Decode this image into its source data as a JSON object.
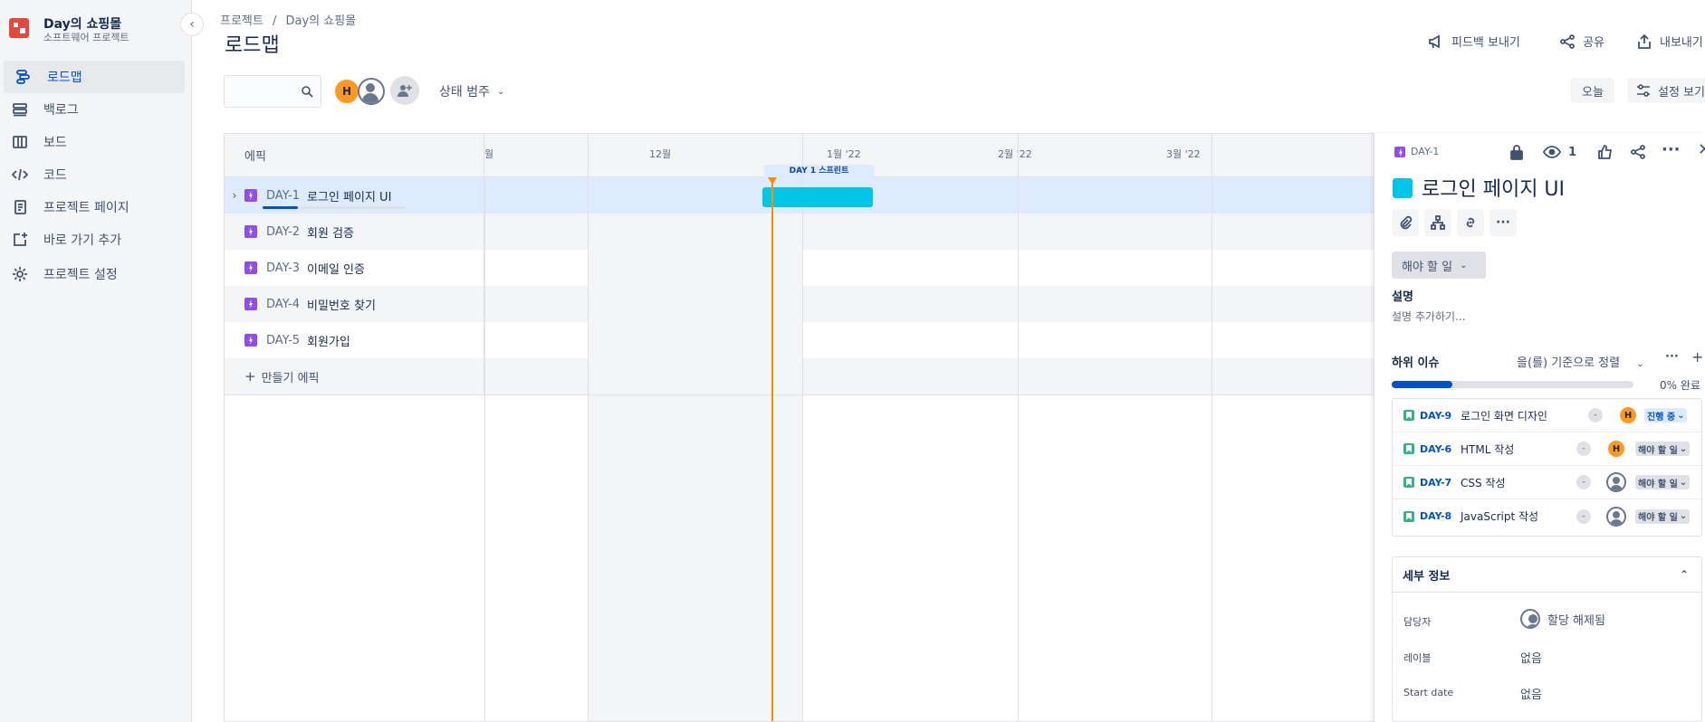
{
  "project": {
    "name": "Day의 쇼핑몰",
    "type": "소프트웨어 프로젝트"
  },
  "sidebar": {
    "items": [
      {
        "label": "로드맵",
        "icon": "roadmap-icon",
        "active": true
      },
      {
        "label": "백로그",
        "icon": "backlog-icon",
        "active": false
      },
      {
        "label": "보드",
        "icon": "board-icon",
        "active": false
      },
      {
        "label": "코드",
        "icon": "code-icon",
        "active": false
      },
      {
        "label": "프로젝트 페이지",
        "icon": "page-icon",
        "active": false
      },
      {
        "label": "바로 가기 추가",
        "icon": "add-shortcut-icon",
        "active": false
      },
      {
        "label": "프로젝트 설정",
        "icon": "gear-icon",
        "active": false
      }
    ]
  },
  "header": {
    "breadcrumb": [
      "프로젝트",
      "/",
      "Day의 쇼핑몰"
    ],
    "title": "로드맵",
    "feedback": "피드백 보내기",
    "share": "공유",
    "export": "내보내기"
  },
  "toolbar": {
    "search_placeholder": "",
    "avatar_initial": "H",
    "status_filter": "상태 범주",
    "today": "오늘",
    "view_settings": "설정 보기"
  },
  "timeline": {
    "epic_header": "에픽",
    "months": [
      "월",
      "12월",
      "1월 '22",
      "2월 '22",
      "3월 '22"
    ],
    "sprint": "DAY 1 스프린트",
    "create": "만들기 에픽",
    "epics": [
      {
        "key": "DAY-1",
        "title": "로그인 페이지 UI",
        "progress": 0.25
      },
      {
        "key": "DAY-2",
        "title": "회원 검증"
      },
      {
        "key": "DAY-3",
        "title": "이메일 인증"
      },
      {
        "key": "DAY-4",
        "title": "비밀번호 찾기"
      },
      {
        "key": "DAY-5",
        "title": "회원가입"
      }
    ]
  },
  "panel": {
    "key": "DAY-1",
    "watchers": "1",
    "title": "로그인 페이지 UI",
    "status": "해야 할 일",
    "description_label": "설명",
    "description_placeholder": "설명 추가하기...",
    "subissues_label": "하위 이슈",
    "sort_label": "을(를) 기준으로 정렬",
    "progress_text": "0% 완료",
    "subissues": [
      {
        "key": "DAY-9",
        "title": "로그인 화면 디자인",
        "priority": "-",
        "assignee": "H",
        "status": "진행 중",
        "status_kind": "prog"
      },
      {
        "key": "DAY-6",
        "title": "HTML 작성",
        "priority": "-",
        "assignee": "H",
        "status": "해야 할 일",
        "status_kind": "todo"
      },
      {
        "key": "DAY-7",
        "title": "CSS 작성",
        "priority": "-",
        "assignee": "",
        "status": "해야 할 일",
        "status_kind": "todo"
      },
      {
        "key": "DAY-8",
        "title": "JavaScript 작성",
        "priority": "-",
        "assignee": "",
        "status": "해야 할 일",
        "status_kind": "todo"
      }
    ],
    "details_label": "세부 정보",
    "details": [
      {
        "label": "담당자",
        "value": "할당 해제됨"
      },
      {
        "label": "레이블",
        "value": "없음"
      },
      {
        "label": "Start date",
        "value": "없음"
      }
    ]
  },
  "colors": {
    "accent": "#0052cc",
    "epic": "#904ee2",
    "bar": "#00c7e6",
    "today": "#ff8b00",
    "avatar": "#ff991f"
  }
}
